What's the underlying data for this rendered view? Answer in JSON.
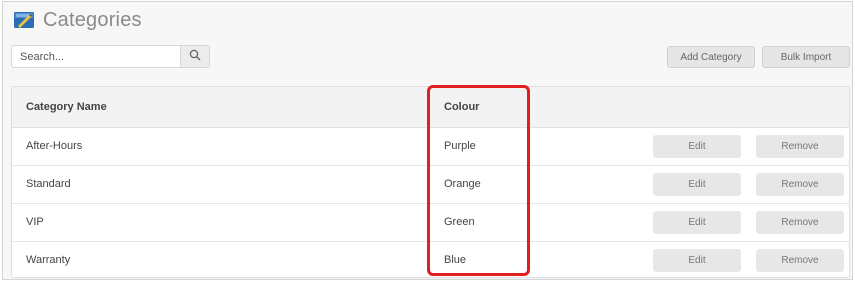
{
  "page": {
    "title": "Categories",
    "icon": "categories-folder-icon"
  },
  "search": {
    "placeholder": "Search...",
    "value": "",
    "icon": "search-icon"
  },
  "toolbar": {
    "add_label": "Add Category",
    "bulk_label": "Bulk Import"
  },
  "table": {
    "columns": {
      "name": "Category Name",
      "colour": "Colour"
    },
    "rows": [
      {
        "name": "After-Hours",
        "colour": "Purple",
        "edit": "Edit",
        "remove": "Remove"
      },
      {
        "name": "Standard",
        "colour": "Orange",
        "edit": "Edit",
        "remove": "Remove"
      },
      {
        "name": "VIP",
        "colour": "Green",
        "edit": "Edit",
        "remove": "Remove"
      },
      {
        "name": "Warranty",
        "colour": "Blue",
        "edit": "Edit",
        "remove": "Remove"
      }
    ]
  },
  "annotation": {
    "color": "#e02020"
  }
}
